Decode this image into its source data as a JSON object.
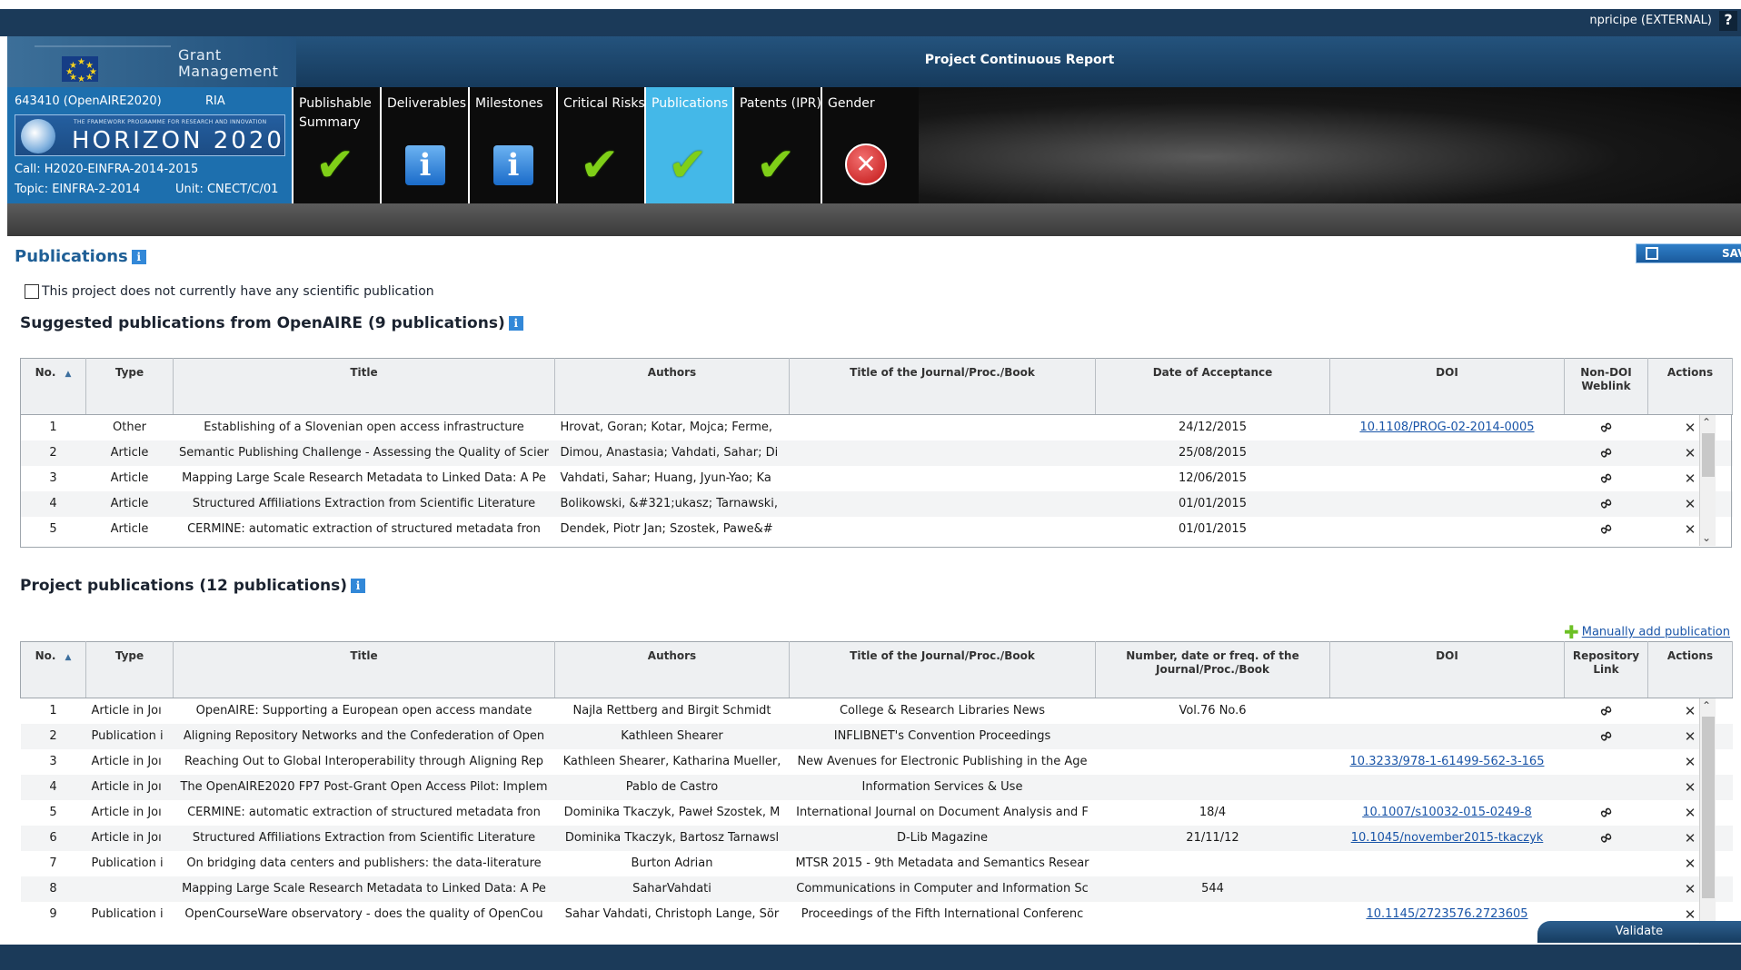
{
  "top": {
    "user": "npricipe (EXTERNAL)",
    "help": "?"
  },
  "title_bar": {
    "brand_line1": "Grant",
    "brand_line2": "Management",
    "report_title": "Project Continuous Report"
  },
  "project": {
    "id": "643410 (OpenAIRE2020)",
    "type": "RIA",
    "programme_tagline": "THE FRAMEWORK PROGRAMME FOR RESEARCH AND INNOVATION",
    "programme": "HORIZON 2020",
    "call": "Call: H2020-EINFRA-2014-2015",
    "topic": "Topic: EINFRA-2-2014",
    "unit": "Unit: CNECT/C/01"
  },
  "tabs": [
    {
      "label": "Publishable Summary",
      "status": "check"
    },
    {
      "label": "Deliverables",
      "status": "info"
    },
    {
      "label": "Milestones",
      "status": "info"
    },
    {
      "label": "Critical Risks",
      "status": "check"
    },
    {
      "label": "Publications",
      "status": "check",
      "active": true
    },
    {
      "label": "Patents (IPR)",
      "status": "check"
    },
    {
      "label": "Gender",
      "status": "error"
    }
  ],
  "page": {
    "title": "Publications",
    "save_label": "SAV",
    "no_pub_label": "This project does not currently have any scientific publication",
    "manual_add": "Manually add publication",
    "validate": "Validate"
  },
  "suggested": {
    "title": "Suggested publications from OpenAIRE (9 publications)",
    "headers": [
      "No.",
      "Type",
      "Title",
      "Authors",
      "Title of the Journal/Proc./Book",
      "Date of Acceptance",
      "DOI",
      "Non-DOI Weblink",
      "Actions"
    ],
    "rows": [
      {
        "no": "1",
        "type": "Other",
        "title": "Establishing of a Slovenian open access infrastructure",
        "authors": "Hrovat, Goran; Kotar, Mojca; Ferme,",
        "journal": "",
        "date": "24/12/2015",
        "doi": "10.1108/PROG-02-2014-0005"
      },
      {
        "no": "2",
        "type": "Article",
        "title": "Semantic Publishing Challenge - Assessing the Quality of Scier",
        "authors": "Dimou, Anastasia; Vahdati, Sahar; Di",
        "journal": "",
        "date": "25/08/2015",
        "doi": ""
      },
      {
        "no": "3",
        "type": "Article",
        "title": "Mapping Large Scale Research Metadata to Linked Data: A Pe",
        "authors": "Vahdati, Sahar; Huang, Jyun-Yao; Ka",
        "journal": "",
        "date": "12/06/2015",
        "doi": ""
      },
      {
        "no": "4",
        "type": "Article",
        "title": "Structured Affiliations Extraction from Scientific Literature",
        "authors": "Bolikowski, &#321;ukasz; Tarnawski,",
        "journal": "",
        "date": "01/01/2015",
        "doi": ""
      },
      {
        "no": "5",
        "type": "Article",
        "title": "CERMINE: automatic extraction of structured metadata fron",
        "authors": "Dendek, Piotr Jan; Szostek, Pawe&#",
        "journal": "",
        "date": "01/01/2015",
        "doi": ""
      }
    ]
  },
  "project_pubs": {
    "title": "Project publications (12 publications)",
    "headers": [
      "No.",
      "Type",
      "Title",
      "Authors",
      "Title of the Journal/Proc./Book",
      "Number, date or freq. of the Journal/Proc./Book",
      "DOI",
      "Repository Link",
      "Actions"
    ],
    "rows": [
      {
        "no": "1",
        "type": "Article in Joı",
        "title": "OpenAIRE: Supporting a European open access mandate",
        "authors": "Najla Rettberg and Birgit Schmidt",
        "journal": "College & Research Libraries News",
        "num": "Vol.76 No.6",
        "doi": "",
        "link": true
      },
      {
        "no": "2",
        "type": "Publication i",
        "title": "Aligning Repository Networks and the Confederation of Open",
        "authors": "Kathleen Shearer",
        "journal": "INFLIBNET's Convention Proceedings",
        "num": "",
        "doi": "",
        "link": true
      },
      {
        "no": "3",
        "type": "Article in Joı",
        "title": "Reaching Out to Global Interoperability through Aligning Rep",
        "authors": "Kathleen Shearer, Katharina Mueller,",
        "journal": "New Avenues for Electronic Publishing in the Age",
        "num": "",
        "doi": "10.3233/978-1-61499-562-3-165",
        "link": false
      },
      {
        "no": "4",
        "type": "Article in Joı",
        "title": "The OpenAIRE2020 FP7 Post-Grant Open Access Pilot: Implem",
        "authors": "Pablo de Castro",
        "journal": "Information Services & Use",
        "num": "",
        "doi": "",
        "link": false
      },
      {
        "no": "5",
        "type": "Article in Joı",
        "title": "CERMINE: automatic extraction of structured metadata fron",
        "authors": "Dominika Tkaczyk, Paweł Szostek, M",
        "journal": "International Journal on Document Analysis and F",
        "num": "18/4",
        "doi": "10.1007/s10032-015-0249-8",
        "link": true
      },
      {
        "no": "6",
        "type": "Article in Joı",
        "title": "Structured Affiliations Extraction from Scientific Literature",
        "authors": "Dominika Tkaczyk, Bartosz Tarnawsl",
        "journal": "D-Lib Magazine",
        "num": "21/11/12",
        "doi": "10.1045/november2015-tkaczyk",
        "link": true
      },
      {
        "no": "7",
        "type": "Publication i",
        "title": "On bridging data centers and publishers: the data-literature",
        "authors": "Burton Adrian",
        "journal": "MTSR 2015 - 9th Metadata and Semantics Resear",
        "num": "",
        "doi": "",
        "link": false
      },
      {
        "no": "8",
        "type": "",
        "title": "Mapping Large Scale Research Metadata to Linked Data: A Pe",
        "authors": "SaharVahdati",
        "journal": "Communications in Computer and Information Sc",
        "num": "544",
        "doi": "",
        "link": false
      },
      {
        "no": "9",
        "type": "Publication i",
        "title": "OpenCourseWare observatory - does the quality of OpenCou",
        "authors": "Sahar Vahdati, Christoph Lange, Sör",
        "journal": "Proceedings of the Fifth International Conferenc",
        "num": "",
        "doi": "10.1145/2723576.2723605",
        "link": false
      }
    ]
  },
  "colors": {
    "navy": "#1b3a59",
    "active_tab": "#44b8e8",
    "project_blue": "#1d6fae",
    "link": "#1a55a8",
    "check": "#7fcf18"
  }
}
